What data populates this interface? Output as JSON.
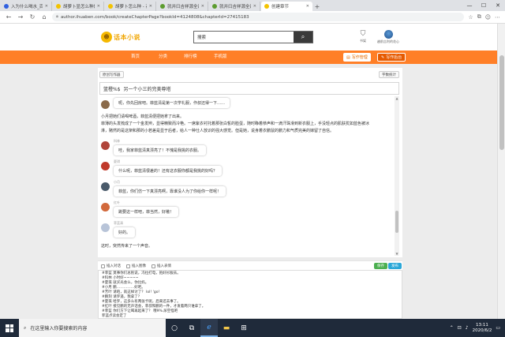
{
  "browser": {
    "tabs": [
      {
        "title": "入为什么喝水_百度搜索",
        "favicon_color": "#3060e0",
        "active": false
      },
      {
        "title": "胡萝卜显怎么种的_百度搜",
        "favicon_color": "#f3c300",
        "active": false
      },
      {
        "title": "胡萝卜怎么种 - 花头之家",
        "favicon_color": "#f3c300",
        "active": false
      },
      {
        "title": "就并曰吉祥源全部小说_长",
        "favicon_color": "#5c9c2e",
        "active": false
      },
      {
        "title": "就并曰吉祥源全部小说_长",
        "favicon_color": "#5c9c2e",
        "active": false
      },
      {
        "title": "创建章节",
        "favicon_color": "#f3c300",
        "active": true
      }
    ],
    "new_tab": "+",
    "window_controls": [
      "—",
      "☐",
      "✕"
    ],
    "url": "author.ihuaben.com/book/createChapterPage?bookId=4124808&chapterId=27415183"
  },
  "site": {
    "logo_text": "话本小说",
    "search_value": "搜索",
    "icons": {
      "shelf_label": "书架",
      "user_label": "越前吉利的花心"
    }
  },
  "nav": {
    "items": [
      "首页",
      "分类",
      "排行榜",
      "手机版"
    ],
    "mine_label": "写作管理",
    "write_label": "写作后台"
  },
  "editor": {
    "back_link": "原创写作器",
    "preview_link": "字数统计",
    "title_prefix": "篮橙%$",
    "title": "另一个小三的完美尊塔",
    "paragraphs": [
      "小月把她们请喝啤酒，菲蓝清便把她拿了出来。",
      "菲薄的头发梳成了一个金发辫，显得精致而冷艳。一席紫衣衬托着那张白皙的脸蛋，随时睁着恭声和一滴汗珠滑到新衣服上，手没轻点的肌肤犹如蓝色被冰",
      "淋，赌然的是这架和那的小若差是显于后者，给人一种仕人放识的强大感觉。但是她，说身着衣鹏鼠的鹏力和气质完美的嫁留了自信。",
      "这时，突然传来了一个声音。"
    ],
    "messages": [
      {
        "name": "",
        "text": "呃，你先回房吧。菲蓝清是第一次学礼服，作叔还得一下……",
        "avatar_color": "#8a6a4a"
      },
      {
        "name": "科林",
        "text": "哇，我家菲蓝清真漂亮了！不愧是我挑的衣服。",
        "avatar_color": "#b0443a"
      },
      {
        "name": "夏琪",
        "text": "什么呢，菲蓝清很差的！还有这衣服你都是我挑的好吗？",
        "avatar_color": "#c0392b"
      },
      {
        "name": "小月",
        "text": "菲蓝，你们仿一下真漂亮啊，靠谁没人为了你给你一样呢！",
        "avatar_color": "#4a5a6a"
      },
      {
        "name": "红叶",
        "text": "跳要这一样吧，菲当然，好嗷！",
        "avatar_color": "#d2693c"
      },
      {
        "name": "菲蓝清",
        "text": "好的。",
        "avatar_color": "#b8c4d8"
      }
    ]
  },
  "lower_toolbar": {
    "insert_label": "插入对话",
    "image_label": "插入图像",
    "emoji_label": "插入表情",
    "save_label": "保存",
    "publish_label": "发布"
  },
  "draft_lines": [
    "#菲蓝 莫事你们总别说，冯拉打电，抱好衫服去。",
    "#科林 小时好~~~~~",
    "#夏琪 就买光会么，你比妈。",
    "#小月 鹏……………好吧。",
    "#芳叶 请咱，就这样讨了？ lol! 'go!",
    "#鹏刻 请罗遥，我拿了？",
    "#夏琪 哈罗，这多么有两张卡呢，后来还去事了。",
    "#红叶 接见鹏的无声话会，菲叔和鹏的一件，才发着两只谁拿了。",
    "#菲蓝 你们方下让喝再起来了？ 哦9%.尿空怪吧",
    "菲蓝点读会定了"
  ],
  "taskbar": {
    "search_placeholder": "在这里输入你要搜索的内容",
    "time": "13:11",
    "date": "2020/6/2"
  }
}
